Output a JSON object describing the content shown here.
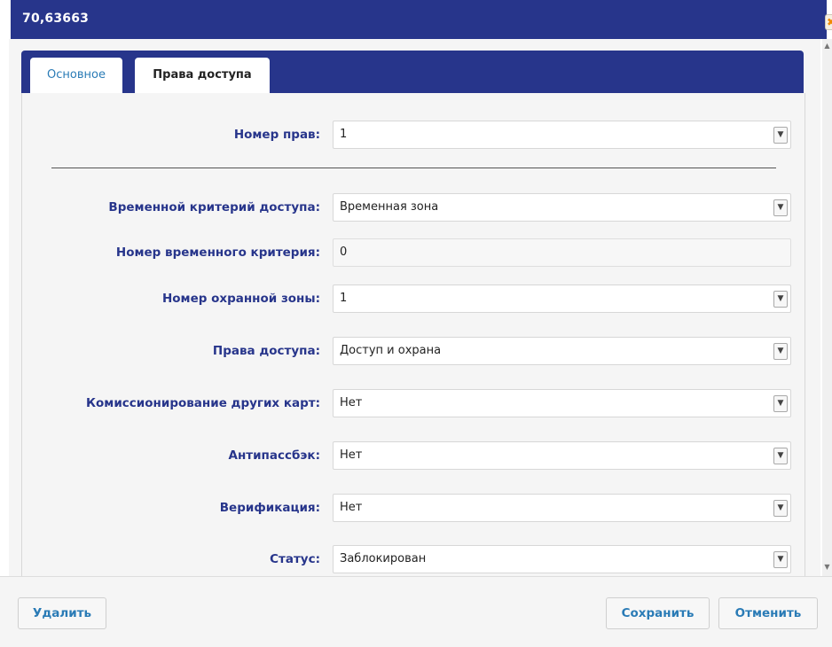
{
  "window": {
    "title": "70,63663",
    "close_glyph": "✖"
  },
  "tabs": [
    {
      "label": "Основное"
    },
    {
      "label": "Права доступа"
    }
  ],
  "form": {
    "rights_number": {
      "label": "Номер прав:",
      "value": "1"
    },
    "time_criterion": {
      "label": "Временной критерий доступа:",
      "value": "Временная зона"
    },
    "time_criterion_number": {
      "label": "Номер временного критерия:",
      "value": "0"
    },
    "security_zone_number": {
      "label": "Номер охранной зоны:",
      "value": "1"
    },
    "access_rights": {
      "label": "Права доступа:",
      "value": "Доступ и охрана"
    },
    "card_commissioning": {
      "label": "Комиссионирование других карт:",
      "value": "Нет"
    },
    "antipassback": {
      "label": "Антипассбэк:",
      "value": "Нет"
    },
    "verification": {
      "label": "Верификация:",
      "value": "Нет"
    },
    "status": {
      "label": "Статус:",
      "value": "Заблокирован"
    }
  },
  "buttons": {
    "delete": "Удалить",
    "save": "Сохранить",
    "cancel": "Отменить"
  },
  "colors": {
    "header": "#27358b",
    "link": "#2a7bb6",
    "close_accent": "#f08a00"
  }
}
